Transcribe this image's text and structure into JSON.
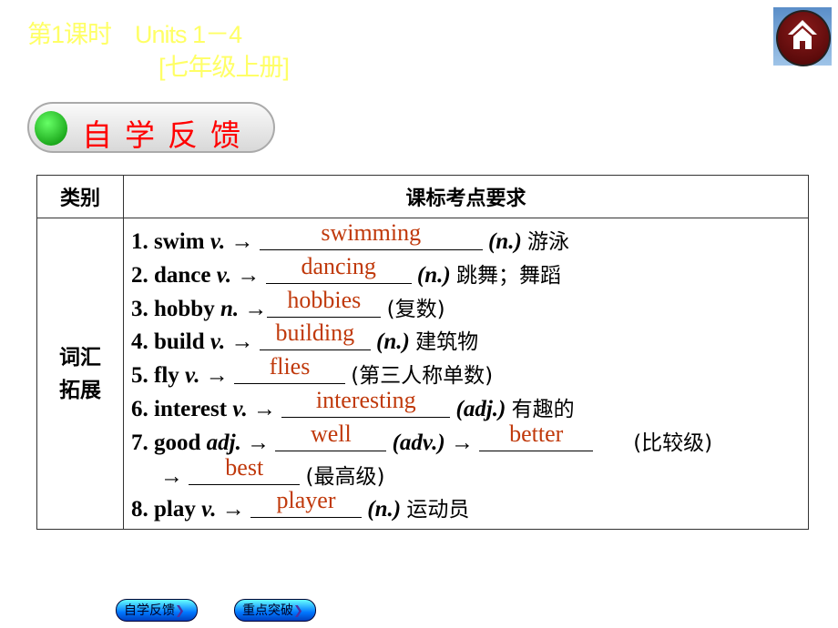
{
  "header": {
    "lesson": "第1课时",
    "units": "Units 1－4",
    "grade": "[七年级上册]"
  },
  "section_title": "自学反馈",
  "table": {
    "headers": [
      "类别",
      "课标考点要求"
    ],
    "category": "词汇拓展",
    "rows": [
      {
        "pre": "1. swim ",
        "pos": "v.",
        "arrow": " → ",
        "answer": "swimming",
        "post_pos": "(n.)",
        "cn": "游泳"
      },
      {
        "pre": "2. dance ",
        "pos": "v.",
        "arrow": " → ",
        "answer": "dancing",
        "post_pos": "(n.)",
        "cn": "跳舞；舞蹈"
      },
      {
        "pre": "3. hobby ",
        "pos": "n.",
        "arrow": " →",
        "answer": "hobbies",
        "post_pos": "",
        "cn": "(复数)"
      },
      {
        "pre": "4. build ",
        "pos": "v.",
        "arrow": " → ",
        "answer": "building",
        "post_pos": "(n.)",
        "cn": "建筑物"
      },
      {
        "pre": "5. fly ",
        "pos": "v.",
        "arrow": " → ",
        "answer": "flies",
        "post_pos": "",
        "cn": "(第三人称单数)"
      },
      {
        "pre": "6. interest ",
        "pos": "v.",
        "arrow": " → ",
        "answer": "interesting",
        "post_pos": "(adj.)",
        "cn": "有趣的"
      },
      {
        "pre": "7. good ",
        "pos": "adj.",
        "arrow": " → ",
        "answer": "well",
        "post_pos": "(adv.)",
        "arrow2": " → ",
        "answer2": "better",
        "cn": "(比较级)"
      },
      {
        "arrow": "→ ",
        "answer": "best",
        "cn": "(最高级)"
      },
      {
        "pre": "8.  play ",
        "pos": "v.",
        "arrow": " → ",
        "answer": "player",
        "post_pos": "(n.)",
        "cn": "运动员"
      }
    ]
  },
  "nav": {
    "btn1": "自学反馈",
    "btn2": "重点突破"
  }
}
